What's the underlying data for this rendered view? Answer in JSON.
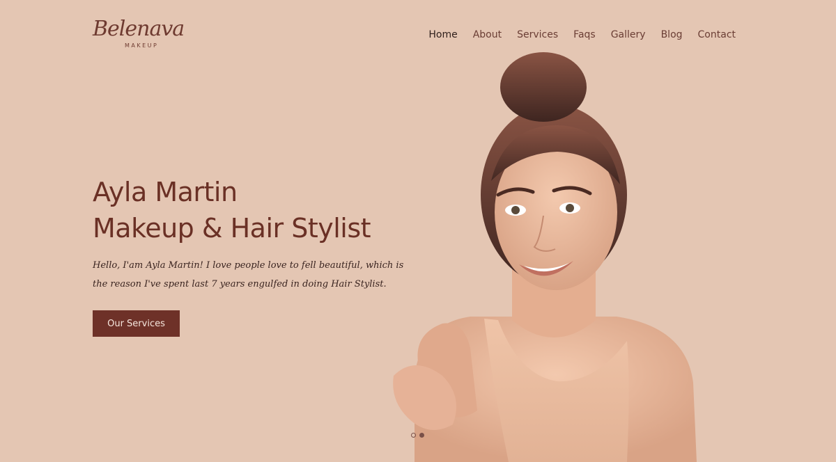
{
  "brand": {
    "logo_script": "Belenava",
    "logo_sub": "MAKEUP"
  },
  "nav": {
    "items": [
      {
        "label": "Home",
        "active": true
      },
      {
        "label": "About"
      },
      {
        "label": "Services"
      },
      {
        "label": "Faqs"
      },
      {
        "label": "Gallery"
      },
      {
        "label": "Blog"
      },
      {
        "label": "Contact"
      }
    ]
  },
  "hero": {
    "title_line1": "Ayla  Martin",
    "title_line2": "Makeup &  Hair Stylist",
    "description": "Hello, I'am Ayla Martin! I love people love to fell beautiful, which is the reason I've spent last 7 years engulfed in doing Hair Stylist.",
    "cta_label": "Our Services"
  },
  "slider": {
    "total": 2,
    "active_index": 1
  },
  "colors": {
    "background": "#e4c6b3",
    "accent": "#6e3128",
    "heading": "#6a3025"
  }
}
